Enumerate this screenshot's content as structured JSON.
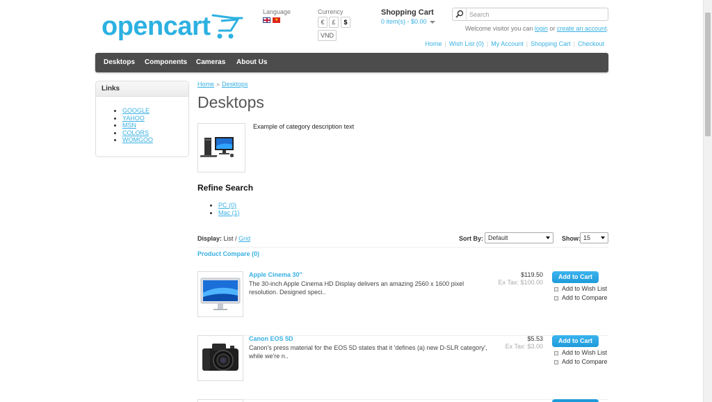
{
  "header": {
    "logo_text": "opencart",
    "language_label": "Language",
    "languages": [
      "English",
      "Vietnamese"
    ],
    "currency_label": "Currency",
    "currencies": [
      "€",
      "£",
      "$",
      "VND"
    ],
    "cart_title": "Shopping Cart",
    "cart_summary": "0 item(s) - $0.00",
    "search_placeholder": "Search",
    "welcome_prefix": "Welcome visitor you can",
    "login_link": "login",
    "welcome_or": "or",
    "create_account_link": "create an account",
    "welcome_suffix": ".",
    "top_links": [
      "Home",
      "Wish List (0)",
      "My Account",
      "Shopping Cart",
      "Checkout"
    ]
  },
  "menu": [
    "Desktops",
    "Components",
    "Cameras",
    "About Us"
  ],
  "sidebar": {
    "title": "Links",
    "links": [
      "GOOGLE",
      "YAHOO",
      "MSN",
      "COLORS",
      "WOMGOO"
    ]
  },
  "content": {
    "breadcrumb": [
      "Home",
      "Desktops"
    ],
    "breadcrumb_sep": "»",
    "heading": "Desktops",
    "category_description": "Example of category description text",
    "refine_title": "Refine Search",
    "refine_links": [
      "PC (0)",
      "Mac (1)"
    ],
    "display_label": "Display:",
    "display_list": "List",
    "display_sep": "/",
    "display_grid": "Grid",
    "sort_label": "Sort By:",
    "sort_value": "Default",
    "show_label": "Show:",
    "show_value": "15",
    "compare_link": "Product Compare (0)"
  },
  "products": [
    {
      "name": "Apple Cinema 30\"",
      "description": "The 30-inch Apple Cinema HD Display delivers an amazing 2560 x 1600 pixel resolution. Designed speci..",
      "price": "$119.50",
      "ex_tax": "Ex Tax: $100.00",
      "add_to_cart": "Add to Cart",
      "wish_list": "Add to Wish List",
      "compare": "Add to Compare"
    },
    {
      "name": "Canon EOS 5D",
      "description": "Canon's press material for the EOS 5D states that it 'defines (a) new D-SLR category', while we're n..",
      "price": "$5.53",
      "ex_tax": "Ex Tax: $3.00",
      "add_to_cart": "Add to Cart",
      "wish_list": "Add to Wish List",
      "compare": "Add to Compare"
    }
  ],
  "colors": {
    "accent": "#38b0e3",
    "menu_bg": "#4c4c4c",
    "button": "#1d9bd9"
  }
}
